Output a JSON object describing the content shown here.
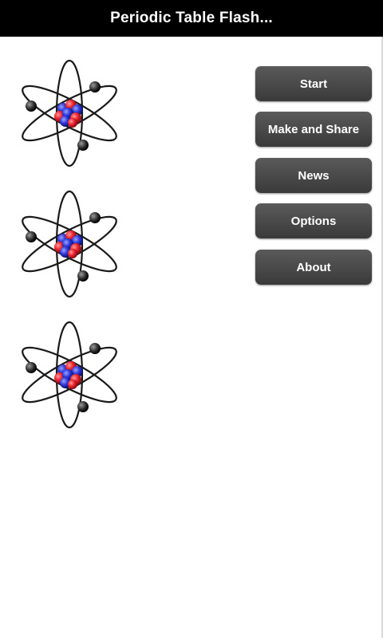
{
  "app": {
    "title": "Periodic Table Flash..."
  },
  "menu": {
    "items": [
      {
        "label": "Start"
      },
      {
        "label": "Make and Share"
      },
      {
        "label": "News"
      },
      {
        "label": "Options"
      },
      {
        "label": "About"
      }
    ]
  },
  "icons": {
    "atom": "atom-icon"
  },
  "colors": {
    "title_bar_bg": "#000000",
    "button_bg": "#444444",
    "proton": "#e8202a",
    "neutron": "#2a35d8"
  }
}
